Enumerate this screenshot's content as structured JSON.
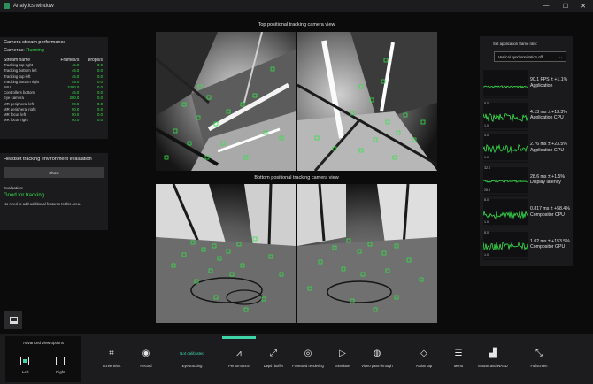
{
  "window": {
    "title": "Analytics window",
    "minimize": "—",
    "maximize": "☐",
    "close": "✕"
  },
  "stream_panel": {
    "title": "Camera stream performance",
    "cameras_label": "Cameras:",
    "cameras_status": "Running",
    "columns": [
      "Stream name",
      "Frames/s",
      "Drops/s"
    ],
    "rows": [
      [
        "Tracking top right",
        "45.0",
        "0.0"
      ],
      [
        "Tracking bottom left",
        "45.0",
        "0.0"
      ],
      [
        "Tracking top left",
        "45.0",
        "0.0"
      ],
      [
        "Tracking bottom right",
        "45.0",
        "0.0"
      ],
      [
        "IMU",
        "1000.0",
        "0.0"
      ],
      [
        "Controllers bottom",
        "45.0",
        "0.0"
      ],
      [
        "Eye camera",
        "200.0",
        "0.0"
      ],
      [
        "MR peripheral left",
        "90.0",
        "0.0"
      ],
      [
        "MR peripheral right",
        "90.0",
        "0.0"
      ],
      [
        "MR focus left",
        "90.0",
        "0.0"
      ],
      [
        "MR focus right",
        "90.0",
        "0.0"
      ]
    ]
  },
  "env_panel": {
    "title": "Headset tracking environment evaluation",
    "show_button": "Show",
    "eval_label": "Evaluation:",
    "eval_value": "Good for tracking",
    "note": "No need to add additional features to this area."
  },
  "cameras": {
    "top_title": "Top positional tracking camera view",
    "bottom_title": "Bottom positional tracking camera view"
  },
  "right_panel": {
    "frame_rate_label": "Set application frame rate:",
    "frame_rate_value": "Vertical synchronization off",
    "metrics": [
      {
        "axis_top": "",
        "axis_bot": "",
        "value": "90.1 FPS ± +1.1%",
        "label": "Application",
        "level": 0.35
      },
      {
        "axis_top": "8.0",
        "axis_bot": "1.0",
        "value": "4.13 ms ± +13.3%",
        "label": "Application CPU",
        "level": 0.45
      },
      {
        "axis_top": "4.0",
        "axis_bot": "1.0",
        "value": "2.76 ms ± +23.5%",
        "label": "Application GPU",
        "level": 0.5
      },
      {
        "axis_top": "32.0",
        "axis_bot": "26.0",
        "value": "28.6 ms ± +1.5%",
        "label": "Display latency",
        "level": 0.5
      },
      {
        "axis_top": "8.0",
        "axis_bot": "1.0",
        "value": "0.817 ms ± +58.4%",
        "label": "Compositor CPU",
        "level": 0.4
      },
      {
        "axis_top": "8.0",
        "axis_bot": "1.0",
        "value": "1.02 ms ± +153.5%",
        "label": "Compositor GPU",
        "level": 0.5
      }
    ]
  },
  "advanced": {
    "title": "Advanced view options",
    "left": "Left",
    "right": "Right",
    "left_checked": true,
    "right_checked": false
  },
  "toolbar": {
    "not_calibrated": "Not calibrated",
    "tools": [
      {
        "name": "screenshot",
        "label": "Screenshot",
        "icon": "⌗"
      },
      {
        "name": "record",
        "label": "Record",
        "icon": "◉"
      },
      {
        "name": "eye-tracking",
        "label": "Eye-tracking",
        "icon": ""
      },
      {
        "name": "performance",
        "label": "Performance",
        "icon": "⩘"
      },
      {
        "name": "depth-buffer",
        "label": "Depth buffer",
        "icon": "⤢"
      },
      {
        "name": "foveated-rendering",
        "label": "Foveated rendering",
        "icon": "◎"
      },
      {
        "name": "simulate",
        "label": "Simulate",
        "icon": "▷"
      },
      {
        "name": "video-pass-through",
        "label": "Video pass-through",
        "icon": "◍"
      },
      {
        "name": "action-tap",
        "label": "Action tap",
        "icon": "◇"
      },
      {
        "name": "menu",
        "label": "Menu",
        "icon": "☰"
      },
      {
        "name": "mouse-and-wasd",
        "label": "Mouse and WASD",
        "icon": "▟"
      },
      {
        "name": "fullscreen",
        "label": "Fullscreen",
        "icon": "⤡"
      }
    ]
  },
  "colors": {
    "accent": "#35e04a",
    "highlight": "#3ed3a8"
  }
}
